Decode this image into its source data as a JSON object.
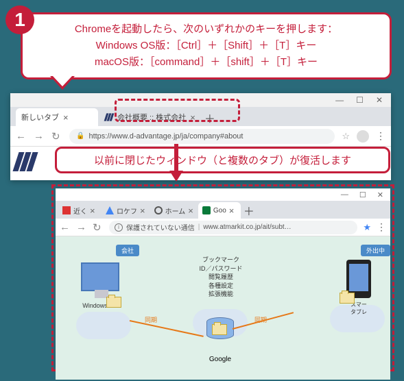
{
  "step_number": "1",
  "callout1": {
    "line1": "Chromeを起動したら、次のいずれかのキーを押します：",
    "line2": "Windows OS版：［Ctrl］＋［Shift］＋［T］キー",
    "line3": "macOS版：［command］＋［shift］＋［T］キー"
  },
  "callout2": "以前に閉じたウィンドウ（と複数のタブ）が復活します",
  "window1": {
    "controls": {
      "min": "—",
      "max": "☐",
      "close": "✕"
    },
    "tabs": [
      {
        "label": "新しいタブ"
      },
      {
        "label": "会社概要 :: 株式会社"
      }
    ],
    "plus": "＋",
    "nav": {
      "back": "←",
      "forward": "→",
      "reload": "↻"
    },
    "url": "https://www.d-advantage.jp/ja/company#about",
    "menu": "⋮"
  },
  "window2": {
    "controls": {
      "min": "—",
      "max": "☐",
      "close": "✕"
    },
    "tabs": [
      {
        "label": "近く"
      },
      {
        "label": "ロケフ"
      },
      {
        "label": "ホーム"
      },
      {
        "label": "Goo"
      }
    ],
    "plus": "＋",
    "nav": {
      "back": "←",
      "forward": "→",
      "reload": "↻"
    },
    "insecure": "保護されていない通信",
    "url": "www.atmarkit.co.jp/ait/subt…",
    "menu": "⋮",
    "diagram": {
      "tag_company": "会社",
      "tag_out": "外出中",
      "pc_label": "Windows PC",
      "db_title": "ブックマーク\nID／パスワード\n閲覧履歴\n各種設定\n拡張機能",
      "google_label": "Google",
      "phone_label": "スマー\nタブレ",
      "sync": "同期"
    }
  }
}
